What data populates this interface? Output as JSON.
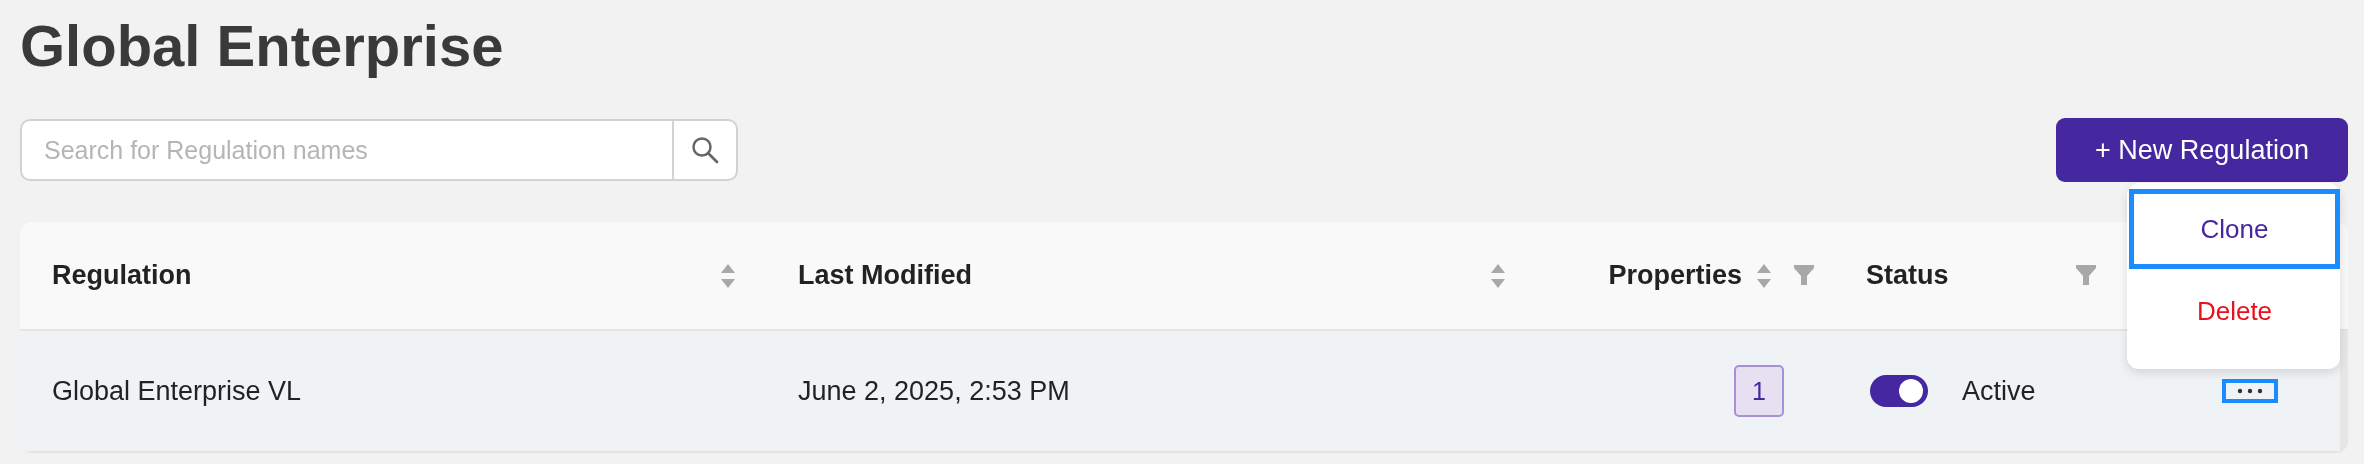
{
  "title": "Global Enterprise",
  "search": {
    "placeholder": "Search for Regulation names"
  },
  "new_button": "+ New Regulation",
  "table": {
    "columns": [
      {
        "label": "Regulation",
        "sortable": true,
        "filterable": false
      },
      {
        "label": "Last Modified",
        "sortable": true,
        "filterable": false
      },
      {
        "label": "Properties",
        "sortable": true,
        "filterable": true
      },
      {
        "label": "Status",
        "sortable": false,
        "filterable": true
      }
    ],
    "rows": [
      {
        "regulation": "Global Enterprise VL",
        "last_modified": "June 2, 2025, 2:53 PM",
        "properties": "1",
        "status": "Active",
        "active": true,
        "actions_focused": true
      }
    ]
  },
  "menu": {
    "items": [
      {
        "label": "Clone",
        "kind": "normal",
        "focused": true
      },
      {
        "label": "Delete",
        "kind": "danger",
        "focused": false
      }
    ]
  }
}
